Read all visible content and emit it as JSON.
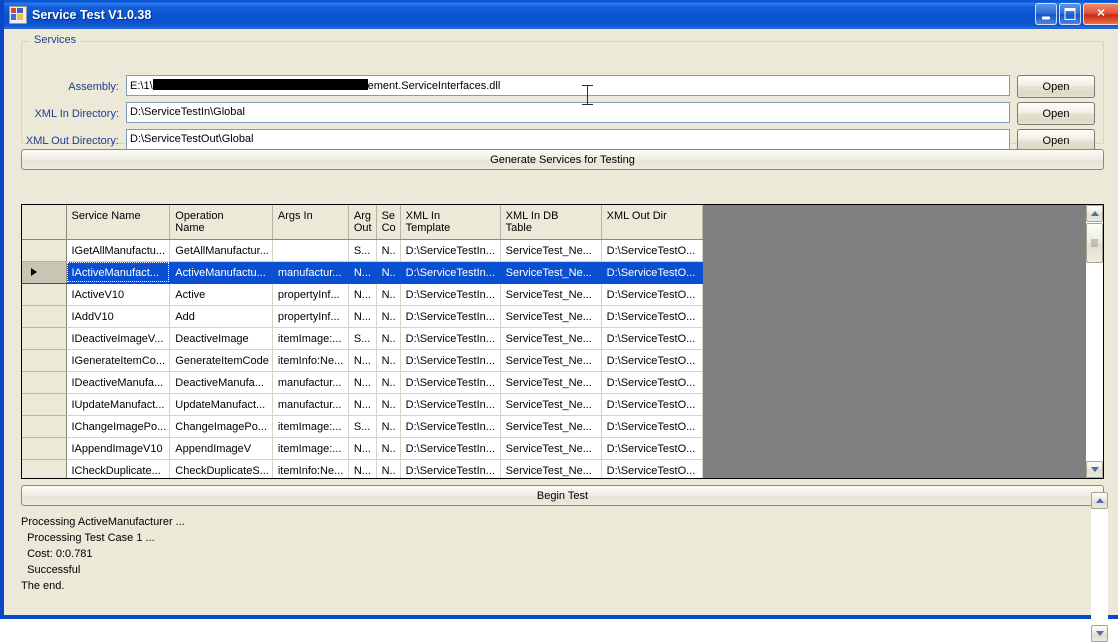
{
  "window": {
    "title": "Service Test V1.0.38",
    "minimize_label": "Minimize",
    "maximize_label": "Maximize",
    "close_label": "Close"
  },
  "services_group": {
    "legend": "Services",
    "assembly_label": "Assembly:",
    "assembly_value_prefix": "E:\\1\\",
    "assembly_value_suffix": "ement.ServiceInterfaces.dll",
    "xml_in_label": "XML In Directory:",
    "xml_in_value": "D:\\ServiceTestIn\\Global",
    "xml_out_label": "XML Out Directory:",
    "xml_out_value": "D:\\ServiceTestOut\\Global",
    "open_label": "Open"
  },
  "actions": {
    "generate_label": "Generate Services for Testing",
    "begin_test_label": "Begin Test"
  },
  "grid": {
    "columns": [
      "",
      "Service Name",
      "Operation\nName",
      "Args In",
      "Arg\nOut",
      "Se\nCo",
      "XML In\nTemplate",
      "XML In DB\nTable",
      "XML Out Dir"
    ],
    "rows": [
      {
        "selected": false,
        "marker": false,
        "cells": [
          "IGetAllManufactu...",
          "GetAllManufactur...",
          "",
          "S...",
          "N..",
          "D:\\ServiceTestIn...",
          "ServiceTest_Ne...",
          "D:\\ServiceTestO..."
        ]
      },
      {
        "selected": true,
        "marker": true,
        "cells": [
          "IActiveManufact...",
          "ActiveManufactu...",
          "manufactur...",
          "N...",
          "N..",
          "D:\\ServiceTestIn...",
          "ServiceTest_Ne...",
          "D:\\ServiceTestO..."
        ]
      },
      {
        "selected": false,
        "marker": false,
        "cells": [
          "IActiveV10",
          "Active",
          "propertyInf...",
          "N...",
          "N..",
          "D:\\ServiceTestIn...",
          "ServiceTest_Ne...",
          "D:\\ServiceTestO..."
        ]
      },
      {
        "selected": false,
        "marker": false,
        "cells": [
          "IAddV10",
          "Add",
          "propertyInf...",
          "N...",
          "N..",
          "D:\\ServiceTestIn...",
          "ServiceTest_Ne...",
          "D:\\ServiceTestO..."
        ]
      },
      {
        "selected": false,
        "marker": false,
        "cells": [
          "IDeactiveImageV...",
          "DeactiveImage",
          "itemImage:...",
          "S...",
          "N..",
          "D:\\ServiceTestIn...",
          "ServiceTest_Ne...",
          "D:\\ServiceTestO..."
        ]
      },
      {
        "selected": false,
        "marker": false,
        "cells": [
          "IGenerateItemCo...",
          "GenerateItemCode",
          "itemInfo:Ne...",
          "N...",
          "N..",
          "D:\\ServiceTestIn...",
          "ServiceTest_Ne...",
          "D:\\ServiceTestO..."
        ]
      },
      {
        "selected": false,
        "marker": false,
        "cells": [
          "IDeactiveManufa...",
          "DeactiveManufa...",
          "manufactur...",
          "N...",
          "N..",
          "D:\\ServiceTestIn...",
          "ServiceTest_Ne...",
          "D:\\ServiceTestO..."
        ]
      },
      {
        "selected": false,
        "marker": false,
        "cells": [
          "IUpdateManufact...",
          "UpdateManufact...",
          "manufactur...",
          "N...",
          "N..",
          "D:\\ServiceTestIn...",
          "ServiceTest_Ne...",
          "D:\\ServiceTestO..."
        ]
      },
      {
        "selected": false,
        "marker": false,
        "cells": [
          "IChangeImagePo...",
          "ChangeImagePo...",
          "itemImage:...",
          "S...",
          "N..",
          "D:\\ServiceTestIn...",
          "ServiceTest_Ne...",
          "D:\\ServiceTestO..."
        ]
      },
      {
        "selected": false,
        "marker": false,
        "cells": [
          "IAppendImageV10",
          "AppendImageV",
          "itemImage:...",
          "N...",
          "N..",
          "D:\\ServiceTestIn...",
          "ServiceTest_Ne...",
          "D:\\ServiceTestO..."
        ]
      },
      {
        "selected": false,
        "marker": false,
        "cells": [
          "ICheckDuplicate...",
          "CheckDuplicateS...",
          "itemInfo:Ne...",
          "N...",
          "N..",
          "D:\\ServiceTestIn...",
          "ServiceTest_Ne...",
          "D:\\ServiceTestO..."
        ]
      }
    ]
  },
  "log": {
    "text": "Processing ActiveManufacturer ...\n  Processing Test Case 1 ...\n  Cost: 0:0.781\n  Successful\nThe end."
  },
  "colors": {
    "title_bar": "#0b52cf",
    "selection": "#0a4fd0",
    "label_text": "#1f3f8f",
    "face": "#ece9d8",
    "grid_backdrop": "#808080"
  }
}
